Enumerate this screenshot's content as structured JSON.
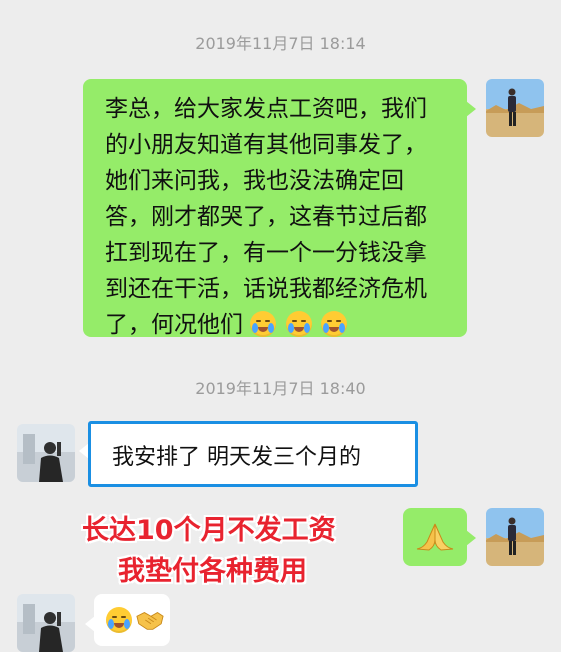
{
  "messages": [
    {
      "timestamp": "2019年11月7日 18:14"
    },
    {
      "sender": "self",
      "lines": [
        "李总，给大家发点工资吧，我们",
        "的小朋友知道有其他同事发了，",
        "她们来问我，我也没法确定回",
        "答，刚才都哭了，这春节过后都",
        "扛到现在了，有一个一分钱没拿",
        "到还在干活，话说我都经济危机",
        "了，何况他们"
      ],
      "trailing_emojis": [
        "crying-face",
        "crying-face",
        "crying-face"
      ]
    },
    {
      "timestamp": "2019年11月7日 18:40"
    },
    {
      "sender": "other",
      "text": "我安排了 明天发三个月的",
      "highlight_color": "#1a8fe3"
    },
    {
      "sender": "self",
      "emoji": "pray-hands"
    },
    {
      "sender": "other",
      "emojis": [
        "crying-face",
        "handshake"
      ]
    }
  ],
  "annotation": {
    "line1": "长达10个月不发工资",
    "line2": "我垫付各种费用",
    "color": "#e8232f"
  },
  "colors": {
    "background": "#ededed",
    "self_bubble": "#95ec69",
    "other_bubble": "#ffffff"
  }
}
